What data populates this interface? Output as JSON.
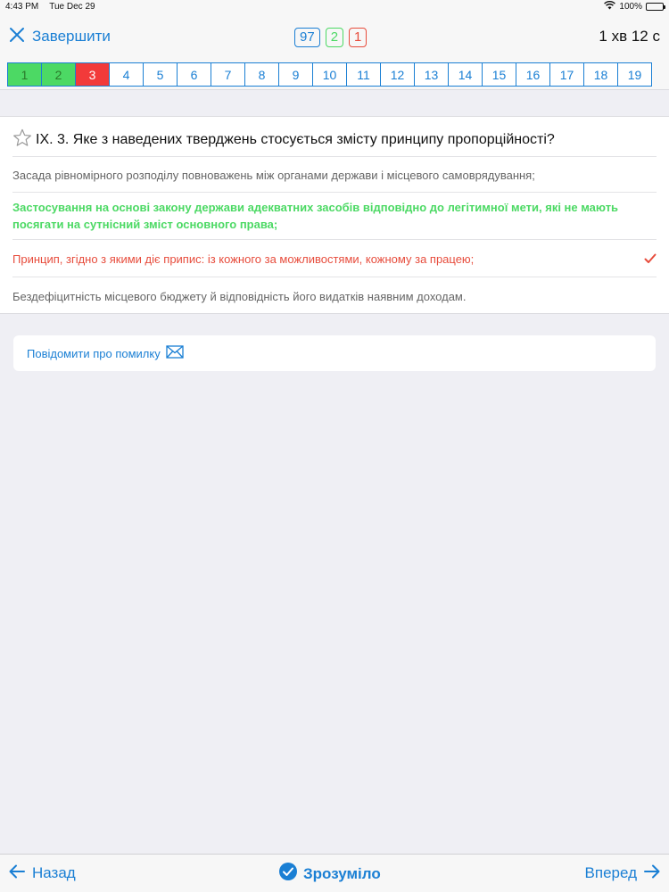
{
  "status_bar": {
    "time": "4:43 PM",
    "date": "Tue Dec 29",
    "battery": "100%"
  },
  "header": {
    "finish_label": "Завершити",
    "counters": {
      "total": "97",
      "correct": "2",
      "wrong": "1"
    },
    "timer": "1 хв 12 с"
  },
  "question_strip": {
    "items": [
      {
        "num": "1",
        "state": "correct"
      },
      {
        "num": "2",
        "state": "correct"
      },
      {
        "num": "3",
        "state": "wrong"
      },
      {
        "num": "4",
        "state": "none"
      },
      {
        "num": "5",
        "state": "none"
      },
      {
        "num": "6",
        "state": "none"
      },
      {
        "num": "7",
        "state": "none"
      },
      {
        "num": "8",
        "state": "none"
      },
      {
        "num": "9",
        "state": "none"
      },
      {
        "num": "10",
        "state": "none"
      },
      {
        "num": "11",
        "state": "none"
      },
      {
        "num": "12",
        "state": "none"
      },
      {
        "num": "13",
        "state": "none"
      },
      {
        "num": "14",
        "state": "none"
      },
      {
        "num": "15",
        "state": "none"
      },
      {
        "num": "16",
        "state": "none"
      },
      {
        "num": "17",
        "state": "none"
      },
      {
        "num": "18",
        "state": "none"
      },
      {
        "num": "19",
        "state": "none"
      }
    ]
  },
  "question": {
    "title": "IX. 3. Яке з наведених тверджень стосується змісту принципу пропорційності?",
    "answers": [
      {
        "text": "Засада рівномірного розподілу повноважень між органами держави і місцевого самоврядування;",
        "state": "normal"
      },
      {
        "text": "Застосування на основі закону держави адекватних засобів відповідно до легітимної мети, які не мають посягати на сутнісний зміст основного права;",
        "state": "correct"
      },
      {
        "text": "Принцип, згідно з якими діє припис: із кожного за можливостями, кожному за працею;",
        "state": "wrong"
      },
      {
        "text": "Бездефіцитність місцевого бюджету й відповідність його видатків наявним доходам.",
        "state": "normal"
      }
    ]
  },
  "report": {
    "label": "Повідомити про помилку"
  },
  "bottom": {
    "back_label": "Назад",
    "understood_label": "Зрозуміло",
    "forward_label": "Вперед"
  },
  "colors": {
    "accent": "#1a7fd4",
    "correct": "#4cd964",
    "wrong": "#e74c3c"
  }
}
